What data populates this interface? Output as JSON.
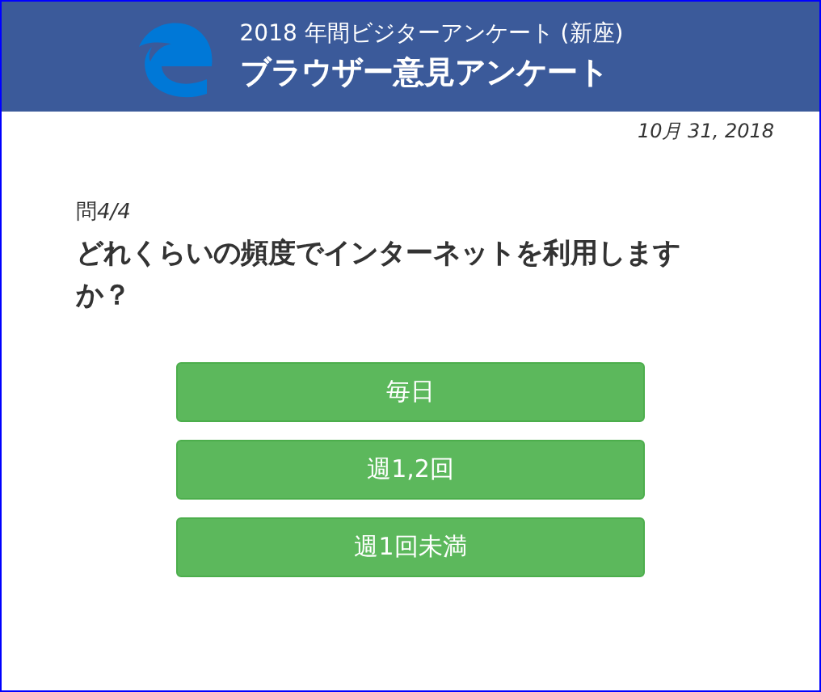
{
  "header": {
    "subtitle": "2018 年間ビジターアンケート (新座)",
    "title": "ブラウザー意見アンケート"
  },
  "date": "10月 31, 2018",
  "question": {
    "label": "問",
    "number": "4/4",
    "text": "どれくらいの頻度でインターネットを利用しますか？"
  },
  "options": [
    "毎日",
    "週1,2回",
    "週1回未満"
  ]
}
